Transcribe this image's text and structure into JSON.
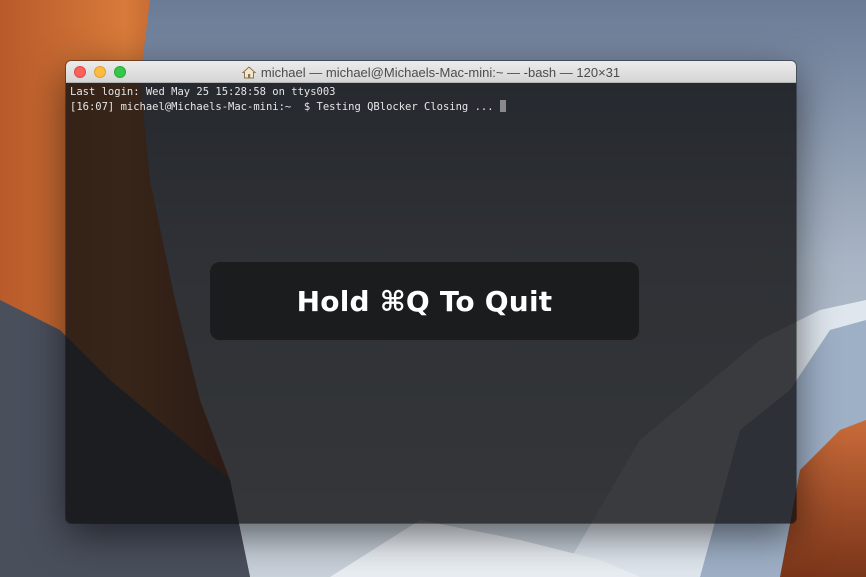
{
  "window": {
    "title": "michael — michael@Michaels-Mac-mini:~ — -bash — 120×31",
    "title_icon": "home-icon",
    "buttons": [
      "close",
      "minimize",
      "zoom"
    ]
  },
  "terminal": {
    "lines": [
      "Last login: Wed May 25 15:28:58 on ttys003",
      "[16:07] michael@Michaels-Mac-mini:~  $ Testing QBlocker Closing ..."
    ]
  },
  "overlay": {
    "message": "Hold ⌘Q To Quit"
  },
  "colors": {
    "close": "#fc605c",
    "minimize": "#fdbc40",
    "zoom": "#34c84a",
    "terminal_bg": "#101012",
    "terminal_text": "#e6e6e6"
  }
}
